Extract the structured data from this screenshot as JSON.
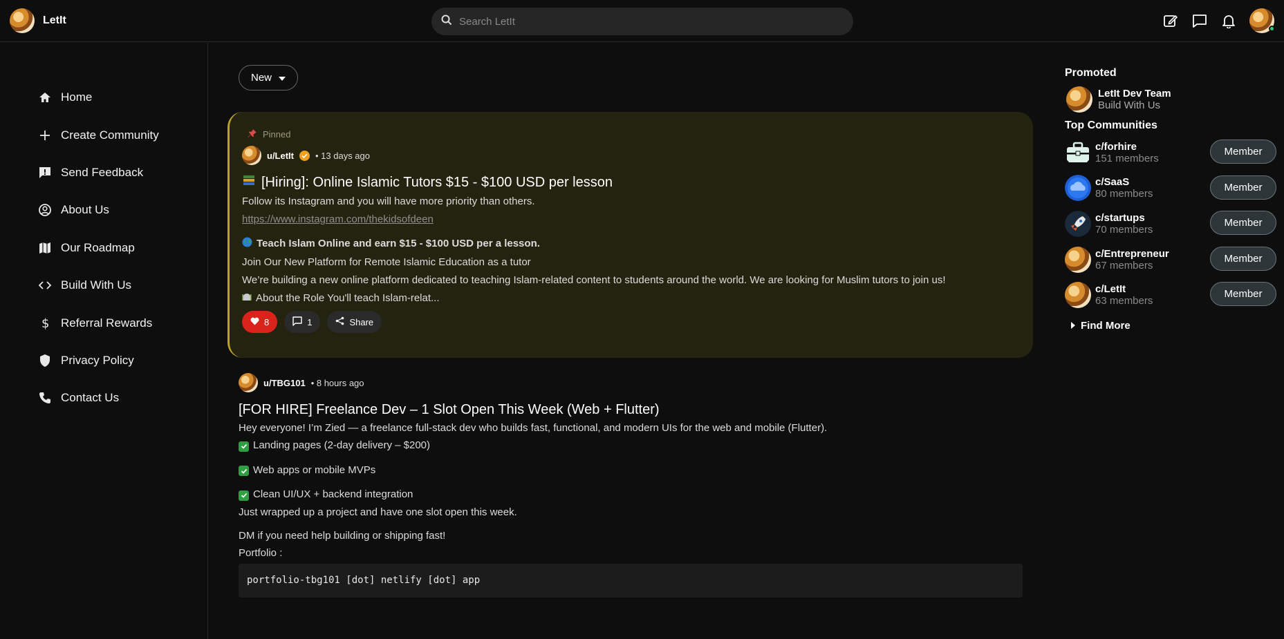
{
  "app": {
    "name": "LetIt"
  },
  "search": {
    "placeholder": "Search LetIt"
  },
  "topbar_icons": [
    "edit-icon",
    "chat-icon",
    "bell-icon"
  ],
  "sidebar": {
    "items": [
      {
        "label": "Home",
        "icon": "home-icon"
      },
      {
        "label": "Create Community",
        "icon": "plus-icon"
      },
      {
        "label": "Send Feedback",
        "icon": "feedback-icon"
      },
      {
        "label": "About Us",
        "icon": "user-circle-icon"
      },
      {
        "label": "Our Roadmap",
        "icon": "map-icon"
      },
      {
        "label": "Build With Us",
        "icon": "code-icon"
      },
      {
        "label": "Referral Rewards",
        "icon": "dollar-icon"
      },
      {
        "label": "Privacy Policy",
        "icon": "shield-icon"
      },
      {
        "label": "Contact Us",
        "icon": "phone-icon"
      }
    ]
  },
  "feed": {
    "sort_label": "New",
    "pinned_post": {
      "pinned_label": "Pinned",
      "author": "u/LetIt",
      "time": "• 13 days ago",
      "title": "[Hiring]: Online Islamic Tutors $15 - $100 USD per lesson",
      "line1": "Follow its Instagram and you will have more priority than others.",
      "link": "https://www.instagram.com/thekidsofdeen",
      "bold_line": "Teach Islam Online and earn $15 - $100 USD per a lesson.",
      "line2": "Join Our New Platform for Remote Islamic Education as a tutor",
      "line3": "We’re building a new online platform dedicated to teaching  Islam-related content to students around the world. We are looking for Muslim tutors to join us!",
      "line4": "About the Role You'll teach Islam-relat...",
      "likes": "8",
      "comments": "1",
      "share_label": "Share"
    },
    "post2": {
      "author": "u/TBG101",
      "time": "• 8 hours ago",
      "title": "[FOR HIRE] Freelance Dev – 1 Slot Open This Week (Web + Flutter)",
      "intro": "Hey everyone! I’m Zied — a freelance full-stack dev who builds fast, functional, and modern UIs for the web and mobile (Flutter).",
      "checks": [
        "Landing pages (2-day delivery – $200)",
        "Web apps or mobile MVPs",
        "Clean UI/UX + backend integration"
      ],
      "line_a": "Just wrapped up a project and have one slot open this week.",
      "line_b": "DM if you need help building or shipping fast!",
      "line_c": "Portfolio :",
      "code": "portfolio-tbg101 [dot] netlify [dot] app"
    }
  },
  "right": {
    "promoted_title": "Promoted",
    "promo": {
      "name": "LetIt Dev Team",
      "sub": "Build With Us"
    },
    "top_title": "Top Communities",
    "communities": [
      {
        "name": "c/forhire",
        "members": "151 members",
        "button": "Member"
      },
      {
        "name": "c/SaaS",
        "members": "80 members",
        "button": "Member"
      },
      {
        "name": "c/startups",
        "members": "70 members",
        "button": "Member"
      },
      {
        "name": "c/Entrepreneur",
        "members": "67 members",
        "button": "Member"
      },
      {
        "name": "c/LetIt",
        "members": "63 members",
        "button": "Member"
      }
    ],
    "find_more": "Find More"
  },
  "colors": {
    "background": "#0e0e0e",
    "pinned_bg": "#24230f",
    "pinned_accent": "#b8a22a",
    "like_red": "#d9241b",
    "verified": "#f0a020",
    "check_green": "#2ea043"
  }
}
